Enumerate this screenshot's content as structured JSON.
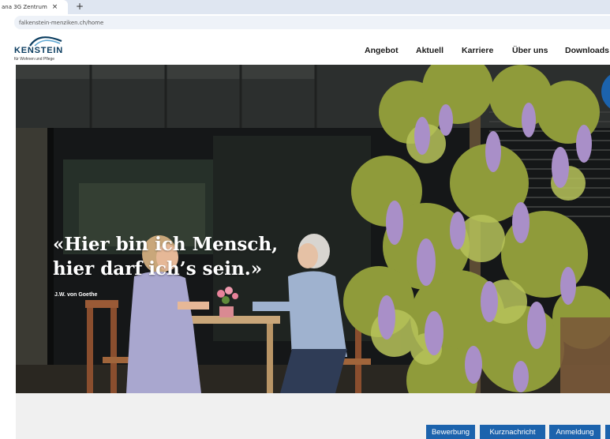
{
  "browser": {
    "tab_title": "ana 3G Zentrum",
    "tab_close": "×",
    "new_tab": "+",
    "url": "falkenstein-menziken.ch/home"
  },
  "site": {
    "logo_name": "KENSTEIN",
    "logo_subtitle": "für Wohnen und Pflege",
    "logo_color": "#0b3d60",
    "nav": [
      "Angebot",
      "Aktuell",
      "Karriere",
      "Über uns",
      "Downloads"
    ]
  },
  "hero": {
    "quote_line1": "«Hier bin ich Mensch,",
    "quote_line2": "hier darf ich’s sein.»",
    "author": "J.W. von Goethe"
  },
  "footer": {
    "buttons": [
      "Bewerbung",
      "Kurznachricht",
      "Anmeldung"
    ],
    "button_color": "#1c63ad"
  }
}
